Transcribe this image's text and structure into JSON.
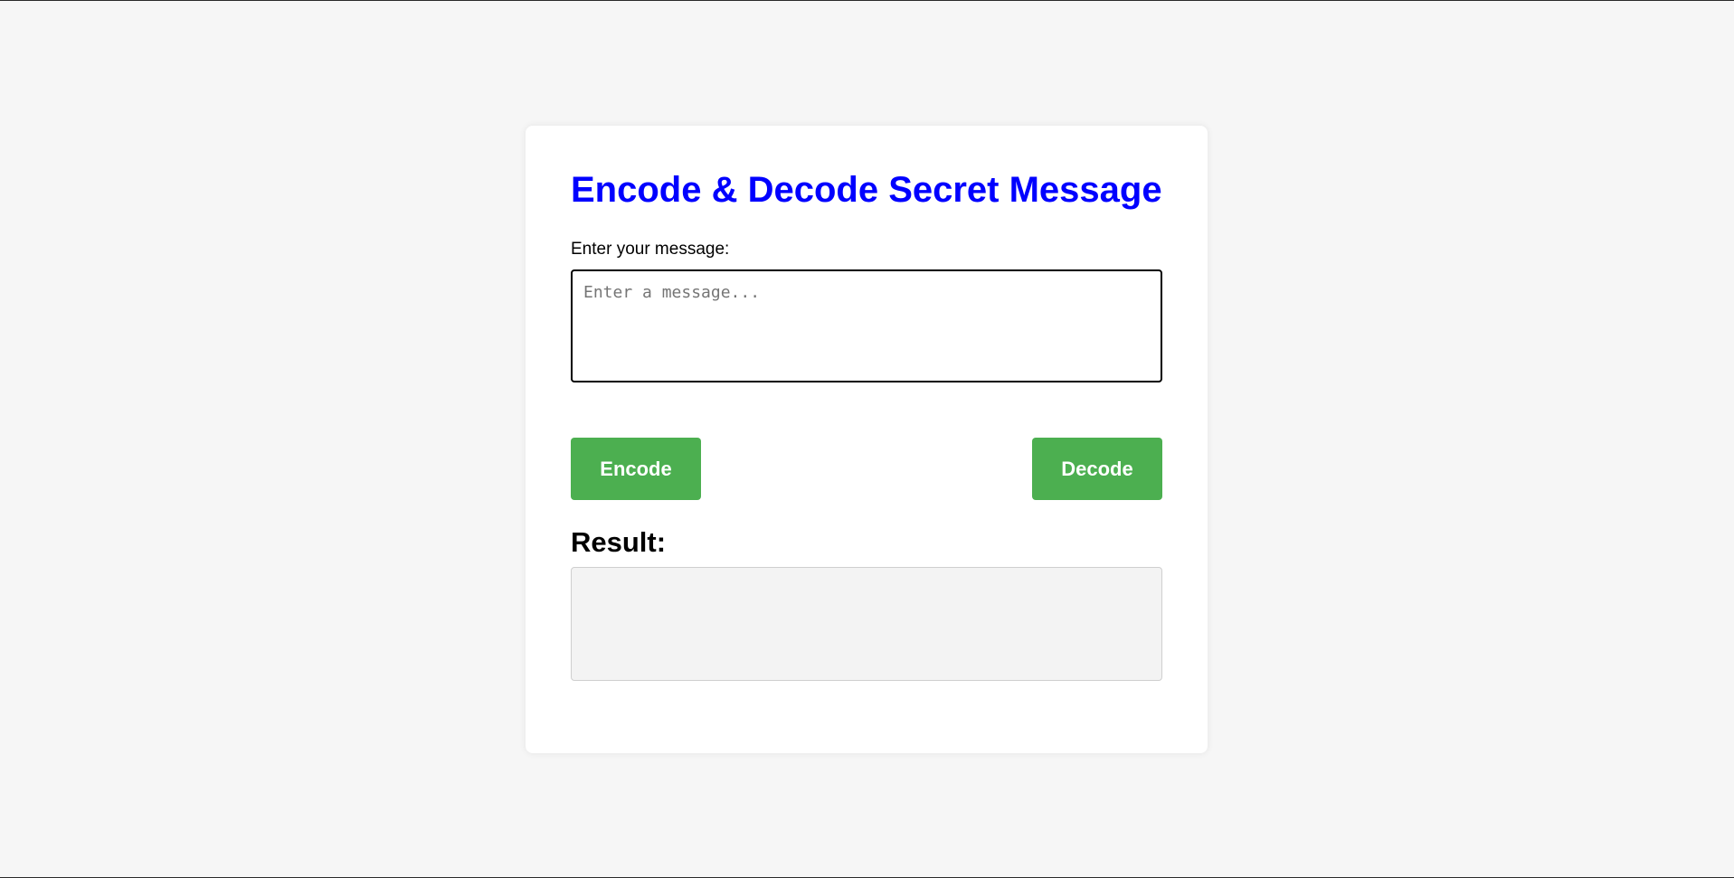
{
  "colors": {
    "title": "#0000ff",
    "button": "#4caf50",
    "page_background": "#f6f6f6",
    "result_background": "#f3f3f3"
  },
  "app": {
    "title": "Encode & Decode Secret Message"
  },
  "form": {
    "message_label": "Enter your message:",
    "message_value": "",
    "message_placeholder": "Enter a message...",
    "encode_label": "Encode",
    "decode_label": "Decode"
  },
  "result": {
    "heading": "Result:",
    "value": ""
  }
}
